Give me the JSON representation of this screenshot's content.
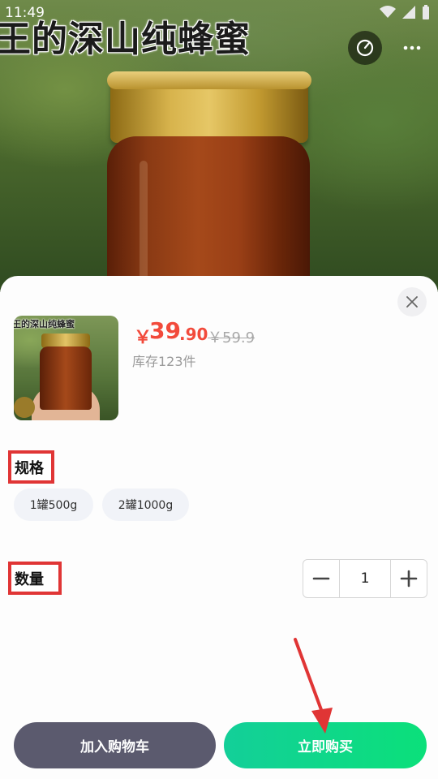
{
  "status_bar": {
    "time": "11:49",
    "icons": [
      "image-icon",
      "download-icon",
      "a-icon",
      "wifi-icon",
      "signal-icon",
      "battery-icon"
    ]
  },
  "hero": {
    "title": "王的深山纯蜂蜜",
    "share_icon": "share-icon",
    "more_icon": "more-icon"
  },
  "product": {
    "thumb_text": "王的深山纯蜂蜜",
    "currency": "￥",
    "price_int": "39",
    "price_dec": ".90",
    "original_price": "￥59.9",
    "stock": "库存123件"
  },
  "spec": {
    "label": "规格",
    "options": [
      "1罐500g",
      "2罐1000g"
    ]
  },
  "quantity": {
    "label": "数量",
    "value": "1"
  },
  "actions": {
    "add_to_cart": "加入购物车",
    "buy_now": "立即购买"
  },
  "colors": {
    "price": "#f24a3b",
    "highlight": "#e03535",
    "cart_button": "#5b5a6e",
    "buy_button": "#0be07a"
  }
}
